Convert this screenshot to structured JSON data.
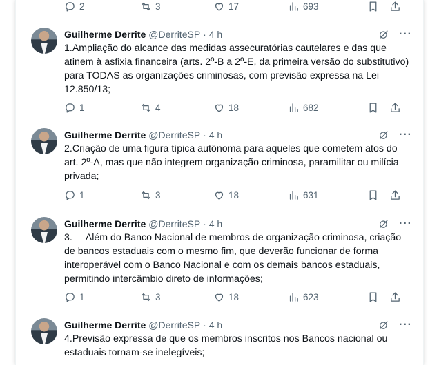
{
  "top_actions": {
    "reply": "2",
    "retweet": "3",
    "like": "17",
    "views": "693"
  },
  "tweets": [
    {
      "author": "Guilherme Derrite",
      "handle": "@DerriteSP",
      "time": "· 4 h",
      "text": "1.Ampliação do alcance das medidas assecuratórias cautelares e das que atinem à asfixia financeira (arts. 2º-B a 2º-E, da primeira versão do substitutivo) para TODAS as organizações criminosas, com previsão expressa na Lei 12.850/13;",
      "reply": "1",
      "retweet": "4",
      "like": "18",
      "views": "682"
    },
    {
      "author": "Guilherme Derrite",
      "handle": "@DerriteSP",
      "time": "· 4 h",
      "text": "2.Criação de uma figura típica autônoma para aqueles que cometem atos do art. 2º-A, mas que não integrem organização criminosa, paramilitar ou milícia privada;",
      "reply": "1",
      "retweet": "3",
      "like": "18",
      "views": "631"
    },
    {
      "author": "Guilherme Derrite",
      "handle": "@DerriteSP",
      "time": "· 4 h",
      "text": "3.     Além do Banco Nacional de membros de organização criminosa, criação de bancos estaduais com o mesmo fim, que deverão funcionar de forma interoperável com o Banco Nacional e com os demais bancos estaduais, permitindo intercâmbio direto de informações;",
      "reply": "1",
      "retweet": "3",
      "like": "18",
      "views": "623"
    },
    {
      "author": "Guilherme Derrite",
      "handle": "@DerriteSP",
      "time": "· 4 h",
      "text": "4.Previsão expressa de que os membros inscritos nos Bancos nacional ou estaduais tornam-se inelegíveis;"
    }
  ],
  "icons": [
    "reply-icon",
    "retweet-icon",
    "like-icon",
    "views-icon",
    "bookmark-icon",
    "share-icon",
    "grok-icon",
    "more-icon"
  ]
}
